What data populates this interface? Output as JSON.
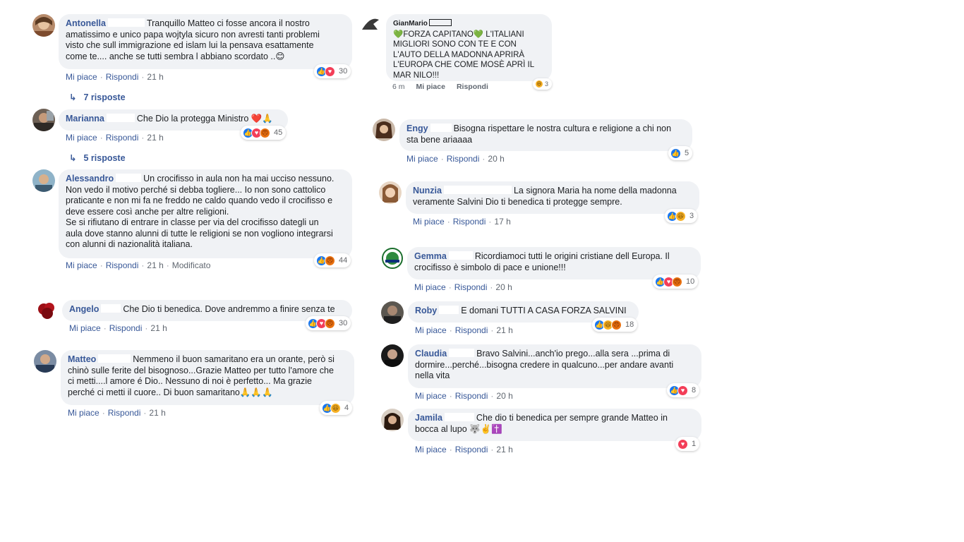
{
  "actions": {
    "like": "Mi piace",
    "reply": "Rispondi"
  },
  "colors": {
    "bubble": "#f0f2f5",
    "name": "#385898",
    "like": "#1877f2",
    "love": "#f33e58",
    "haha": "#f7b125",
    "angry": "#e9710f"
  },
  "left_column": [
    {
      "id": "antonella",
      "name": "Antonella",
      "text": "Tranquillo Matteo ci fosse ancora il nostro\namatissimo e unico papa wojtyla sicuro non avresti tanti problemi\nvisto che sull immigrazione ed islam lui la pensava esattamente\ncome te.... anche se tutti sembra l abbiano scordato ..😊",
      "time": "21 h",
      "reactions": [
        "like",
        "love"
      ],
      "reaction_count": "30",
      "replies": "7 risposte"
    },
    {
      "id": "marianna",
      "name": "Marianna",
      "text": "Che Dio la protegga Ministro ❤️🙏",
      "time": "21 h",
      "reactions": [
        "like",
        "love",
        "angry"
      ],
      "reaction_count": "45",
      "replies": "5 risposte"
    },
    {
      "id": "alessandro",
      "name": "Alessandro",
      "text": "Un crocifisso in aula non ha mai ucciso nessuno.\nNon vedo il motivo perché si debba togliere... Io non sono cattolico\npraticante e non mi fa ne freddo ne caldo quando vedo il crocifisso e\ndeve essere così anche per altre religioni.\nSe si rifiutano di entrare in classe per via del crocifisso dategli un\naula dove stanno alunni di tutte le religioni se non vogliono integrarsi\ncon alunni di nazionalità italiana.",
      "time": "21 h",
      "edited": "Modificato",
      "reactions": [
        "like",
        "angry"
      ],
      "reaction_count": "44"
    },
    {
      "id": "angelo",
      "name": "Angelo",
      "text": "Che Dio ti benedica. Dove andremmo a finire senza te",
      "time": "21 h",
      "reactions": [
        "like",
        "love",
        "angry"
      ],
      "reaction_count": "30"
    },
    {
      "id": "matteo",
      "name": "Matteo",
      "text": "Nemmeno il buon samaritano era un orante, però si\nchinò sulle ferite del bisognoso...Grazie Matteo per tutto l'amore che\nci metti....l amore é Dio.. Nessuno di noi è perfetto... Ma grazie\nperché ci metti il cuore.. Di buon samaritano🙏🙏🙏",
      "time": "21 h",
      "reactions": [
        "like",
        "haha"
      ],
      "reaction_count": "4"
    }
  ],
  "right_column": [
    {
      "id": "gianmario",
      "name": "GianMario",
      "text": "💚FORZA CAPITANO💚 L'ITALIANI\nMIGLIORI SONO CON TE E CON\nL'AUTO DELLA MADONNA APRIRÀ\nL'EUROPA CHE COME MOSÈ APRÌ IL\nMAR NILO!!!",
      "time": "6 m",
      "reactions": [
        "haha"
      ],
      "reaction_count": "3"
    },
    {
      "id": "engy",
      "name": "Engy",
      "text": "Bisogna rispettare le nostra cultura e religione a chi non\nsta bene ariaaaa",
      "time": "20 h",
      "reactions": [
        "like"
      ],
      "reaction_count": "5"
    },
    {
      "id": "nunzia",
      "name": "Nunzia",
      "text": "La signora Maria ha nome della madonna\nveramente Salvini Dio ti benedica ti protegge sempre.",
      "time": "17 h",
      "reactions": [
        "like",
        "haha"
      ],
      "reaction_count": "3"
    },
    {
      "id": "gemma",
      "name": "Gemma",
      "text": "Ricordiamoci tutti le origini cristiane dell Europa. Il\ncrocifisso è simbolo di pace e unione!!!",
      "time": "20 h",
      "reactions": [
        "like",
        "love",
        "angry"
      ],
      "reaction_count": "10"
    },
    {
      "id": "roby",
      "name": "Roby",
      "text": "E domani TUTTI A CASA FORZA SALVINI",
      "time": "21 h",
      "reactions": [
        "like",
        "haha",
        "angry"
      ],
      "reaction_count": "18"
    },
    {
      "id": "claudia",
      "name": "Claudia",
      "text": "Bravo Salvini...anch'io prego...alla sera ...prima di\ndormire...perché...bisogna credere in qualcuno...per andare avanti\nnella vita",
      "time": "20 h",
      "reactions": [
        "like",
        "love"
      ],
      "reaction_count": "8"
    },
    {
      "id": "jamila",
      "name": "Jamila",
      "text": "Che dio ti benedica per sempre grande Matteo in\nbocca al lupo 🐺✌️✝️",
      "time": "21 h",
      "reactions": [
        "love"
      ],
      "reaction_count": "1"
    }
  ]
}
